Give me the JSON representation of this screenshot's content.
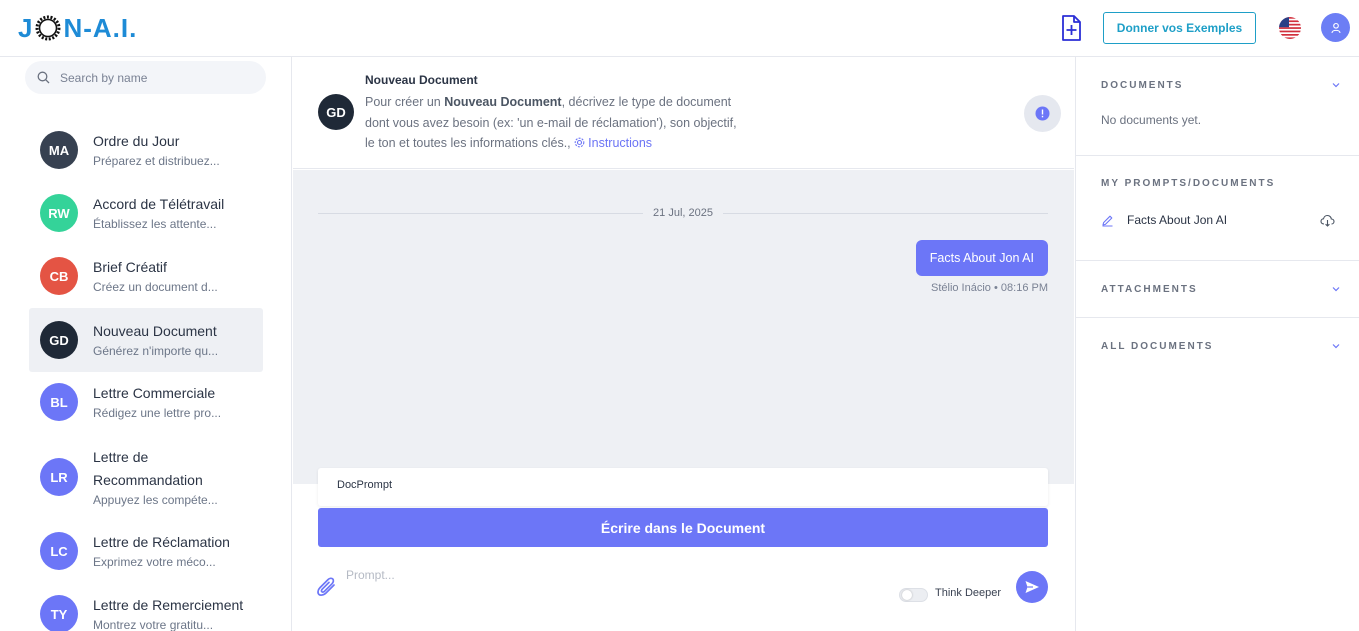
{
  "header": {
    "logo_text_left": "J",
    "logo_text_right": "N-A.I.",
    "new_document_icon": "file-plus-icon",
    "examples_button": "Donner vos Exemples",
    "language_flag": "us-flag-icon",
    "user_icon": "user-icon"
  },
  "sidebar": {
    "search_placeholder": "Search by name",
    "items": [
      {
        "initials": "MA",
        "title": "Ordre du Jour",
        "subtitle": "Préparez et distribuez...",
        "color": "#374151"
      },
      {
        "initials": "RW",
        "title": "Accord de Télétravail",
        "subtitle": "Établissez les attente...",
        "color": "#34d399"
      },
      {
        "initials": "CB",
        "title": "Brief Créatif",
        "subtitle": "Créez un document d...",
        "color": "#e45444"
      },
      {
        "initials": "GD",
        "title": "Nouveau Document",
        "subtitle": "Générez n'importe qu...",
        "color": "#1f2937"
      },
      {
        "initials": "BL",
        "title": "Lettre Commerciale",
        "subtitle": "Rédigez une lettre pro...",
        "color": "#6c76f7"
      },
      {
        "initials": "LR",
        "title": "Lettre de",
        "title2": "Recommandation",
        "subtitle": "Appuyez les compéte...",
        "color": "#6c76f7"
      },
      {
        "initials": "LC",
        "title": "Lettre de Réclamation",
        "subtitle": "Exprimez votre méco...",
        "color": "#6c76f7"
      },
      {
        "initials": "TY",
        "title": "Lettre de Remerciement",
        "subtitle": "Montrez votre gratitu...",
        "color": "#6c76f7"
      }
    ],
    "active_index": 3
  },
  "document": {
    "initials": "GD",
    "title": "Nouveau Document",
    "desc_1": "Pour créer un ",
    "desc_bold": "Nouveau Document",
    "desc_2": ", décrivez le type de document dont vous avez besoin (ex: 'un e-mail de réclamation'), son objectif, le ton et toutes les informations clés., ",
    "instructions_link": "Instructions"
  },
  "chat": {
    "date": "21 Jul, 2025",
    "message": "Facts About Jon AI",
    "author": "Stélio Inácio",
    "time": "08:16 PM",
    "meta_separator": "•"
  },
  "composer": {
    "docprompt_label": "DocPrompt",
    "write_button": "Écrire dans le Document",
    "prompt_placeholder": "Prompt...",
    "think_deeper_label": "Think Deeper",
    "think_deeper_on": false
  },
  "right_panel": {
    "documents_title": "DOCUMENTS",
    "documents_empty": "No documents yet.",
    "my_prompts_title": "MY PROMPTS/DOCUMENTS",
    "my_prompts_items": [
      {
        "name": "Facts About Jon AI"
      }
    ],
    "attachments_title": "ATTACHMENTS",
    "all_documents_title": "ALL DOCUMENTS"
  },
  "colors": {
    "accent": "#6c76f7",
    "logo": "#1e8bd6",
    "examples_border": "#1e9fc7",
    "chat_bg": "#eef0f4"
  }
}
